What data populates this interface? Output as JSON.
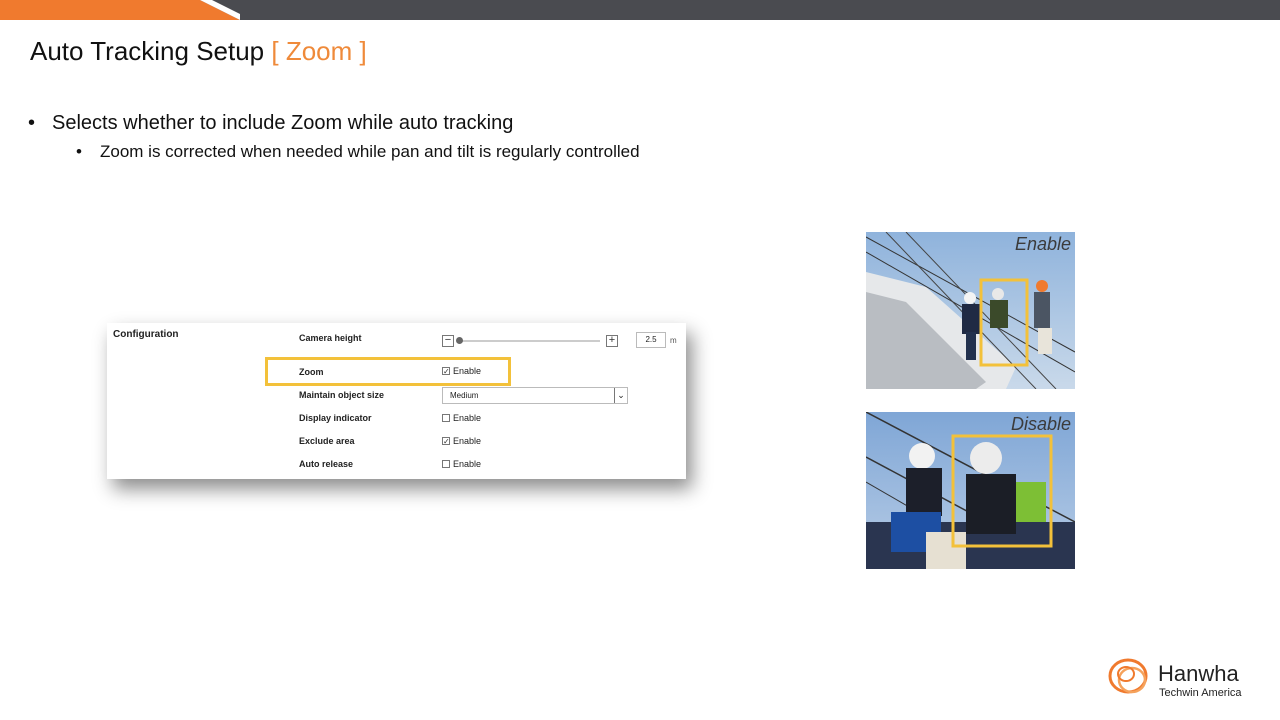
{
  "slide": {
    "title": "Auto Tracking Setup",
    "title_accent": "[ Zoom ]",
    "accent_color": "#ef8a3a",
    "bullets": [
      "Selects whether to include Zoom while auto tracking",
      "Zoom is corrected when needed while pan and tilt is regularly controlled"
    ]
  },
  "config": {
    "section_label": "Configuration",
    "camera_height": {
      "label": "Camera height",
      "value": "2.5",
      "unit": "m"
    },
    "zoom": {
      "label": "Zoom",
      "checked": true,
      "option": "Enable"
    },
    "maintain_object_size": {
      "label": "Maintain object size",
      "selected": "Medium"
    },
    "display_indicator": {
      "label": "Display indicator",
      "checked": false,
      "option": "Enable"
    },
    "exclude_area": {
      "label": "Exclude area",
      "checked": true,
      "option": "Enable"
    },
    "auto_release": {
      "label": "Auto release",
      "checked": false,
      "option": "Enable"
    },
    "highlight_color": "#f3c13a"
  },
  "photos": {
    "enable_label": "Enable",
    "disable_label": "Disable"
  },
  "logo": {
    "name": "Hanwha",
    "sub": "Techwin America"
  }
}
